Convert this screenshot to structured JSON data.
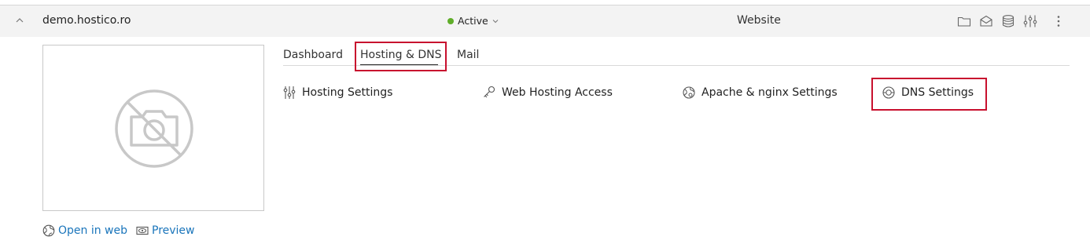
{
  "header": {
    "domain": "demo.hostico.ro",
    "status": "Active",
    "status_color": "#5fad29",
    "site_type": "Website",
    "actions": [
      "folder-icon",
      "mail-icon",
      "database-icon",
      "sliders-icon",
      "more-vertical-icon"
    ]
  },
  "tabs": [
    {
      "label": "Dashboard",
      "active": false
    },
    {
      "label": "Hosting & DNS",
      "active": true
    },
    {
      "label": "Mail",
      "active": false
    }
  ],
  "tools": [
    {
      "label": "Hosting Settings",
      "icon": "sliders-icon"
    },
    {
      "label": "Web Hosting Access",
      "icon": "key-icon"
    },
    {
      "label": "Apache & nginx Settings",
      "icon": "globe-gear-icon"
    },
    {
      "label": "DNS Settings",
      "icon": "globe-icon"
    }
  ],
  "links": {
    "open_in_web": "Open in web",
    "preview": "Preview"
  },
  "colors": {
    "accent_link": "#1a75bb",
    "highlight_box": "#c8102e"
  }
}
